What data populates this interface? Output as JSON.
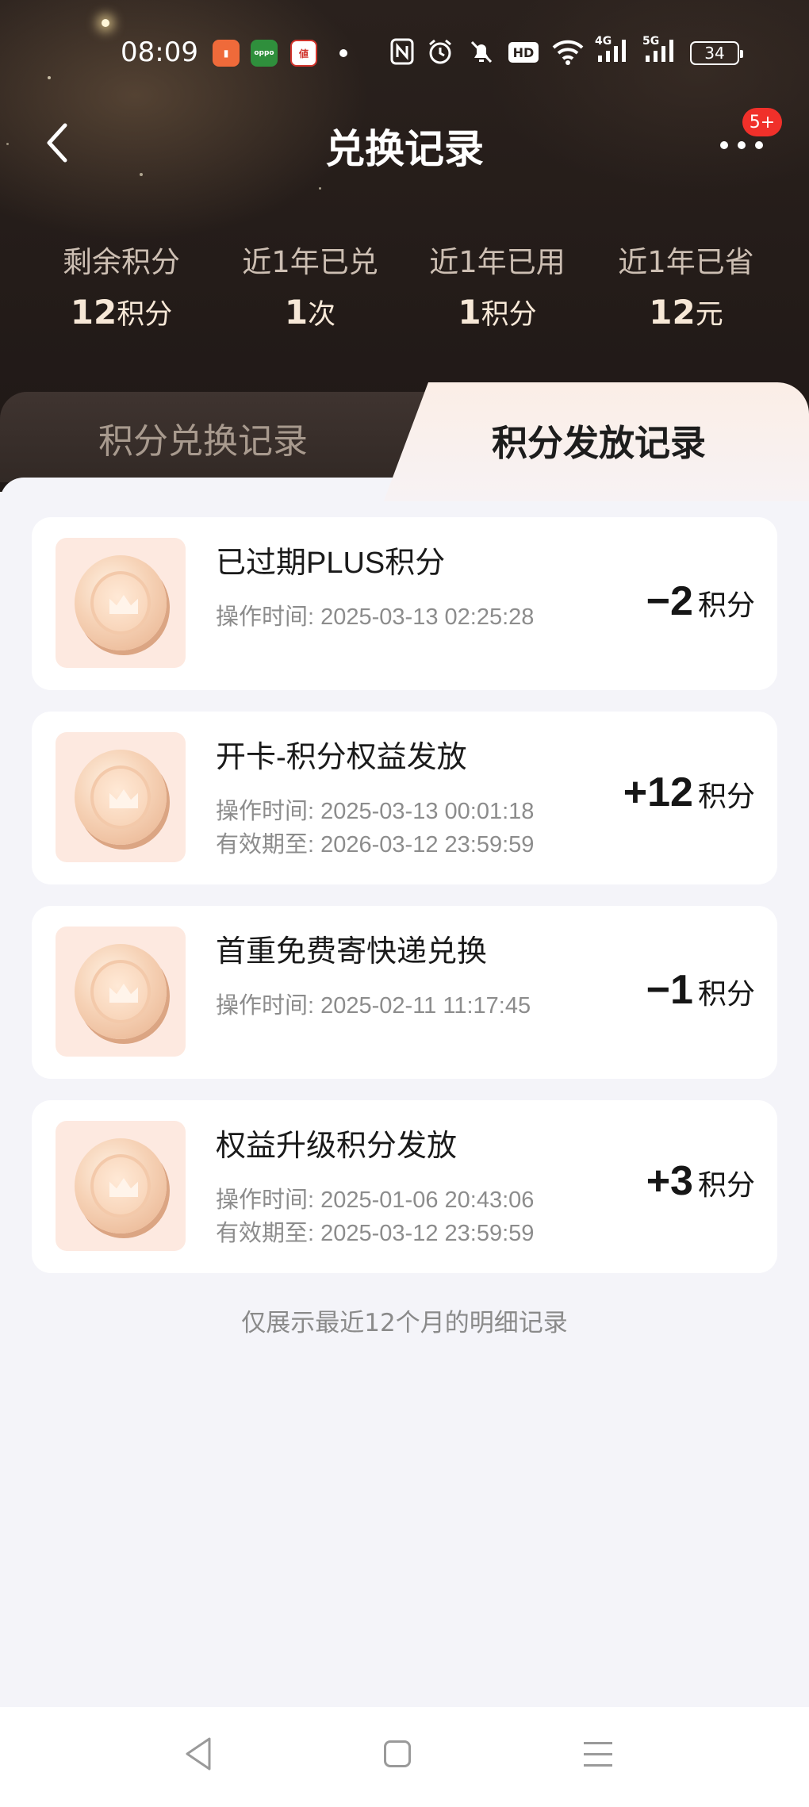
{
  "status_bar": {
    "time": "08:09",
    "battery": "34",
    "network_4g": "4G",
    "network_5g": "5G",
    "hd": "HD"
  },
  "header": {
    "title": "兑换记录",
    "notification_badge": "5+"
  },
  "stats": [
    {
      "label": "剩余积分",
      "value": "12",
      "unit": "积分"
    },
    {
      "label": "近1年已兑",
      "value": "1",
      "unit": "次"
    },
    {
      "label": "近1年已用",
      "value": "1",
      "unit": "积分"
    },
    {
      "label": "近1年已省",
      "value": "12",
      "unit": "元"
    }
  ],
  "tabs": [
    {
      "label": "积分兑换记录",
      "active": false
    },
    {
      "label": "积分发放记录",
      "active": true
    }
  ],
  "records": [
    {
      "title": "已过期PLUS积分",
      "time": "操作时间: 2025-03-13 02:25:28",
      "expiry": "",
      "amount": "−2",
      "unit": "积分"
    },
    {
      "title": "开卡-积分权益发放",
      "time": "操作时间: 2025-03-13 00:01:18",
      "expiry": "有效期至: 2026-03-12 23:59:59",
      "amount": "+12",
      "unit": "积分"
    },
    {
      "title": "首重免费寄快递兑换",
      "time": "操作时间: 2025-02-11 11:17:45",
      "expiry": "",
      "amount": "−1",
      "unit": "积分"
    },
    {
      "title": "权益升级积分发放",
      "time": "操作时间: 2025-01-06 20:43:06",
      "expiry": "有效期至: 2025-03-12 23:59:59",
      "amount": "+3",
      "unit": "积分"
    }
  ],
  "footnote": "仅展示最近12个月的明细记录",
  "icons": {
    "back": "chevron-left-icon",
    "more": "more-dots-icon",
    "coin": "crown-coin-icon"
  }
}
